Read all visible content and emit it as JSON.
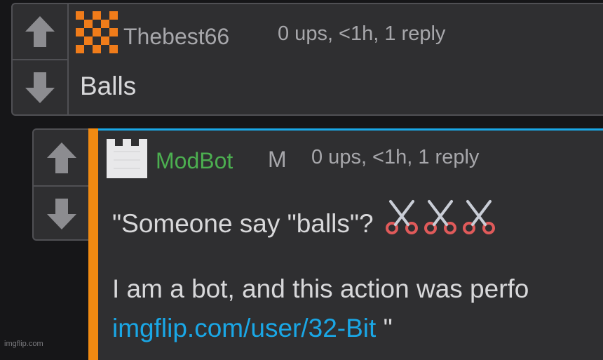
{
  "comments": [
    {
      "username": "Thebest66",
      "meta": "0 ups, <1h, 1 reply",
      "body": "Balls",
      "avatar_colors": [
        "#f07c1a",
        "#2f2f31"
      ]
    },
    {
      "username": "ModBot",
      "mod_flag": "M",
      "meta": "0 ups, <1h, 1 reply",
      "body_line1": "\"Someone say \"balls\"?",
      "body_line2": "I am a bot, and this action was perfo",
      "link_text": "imgflip.com/user/32-Bit",
      "link_suffix": " \"",
      "accent_color": "#f08a12",
      "highlight_color": "#1aa7e6",
      "username_color": "#4caf50"
    }
  ],
  "watermark": "imgflip.com",
  "icons": [
    "upvote-arrow-icon",
    "downvote-arrow-icon",
    "scissors-icon"
  ]
}
